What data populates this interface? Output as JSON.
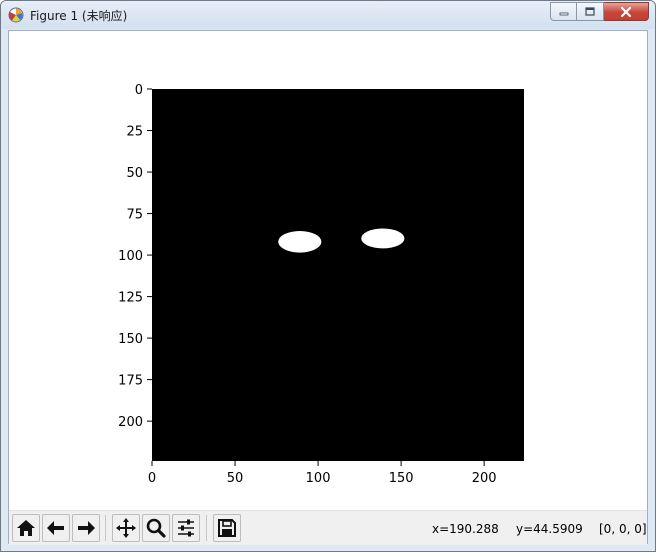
{
  "window": {
    "title": "Figure 1 (未响应)"
  },
  "figure": {
    "y_ticks": [
      "0",
      "25",
      "50",
      "75",
      "100",
      "125",
      "150",
      "175",
      "200"
    ],
    "x_ticks": [
      "0",
      "50",
      "100",
      "150",
      "200"
    ],
    "image_background": "#000000",
    "blob_color": "#ffffff"
  },
  "chart_data": {
    "type": "heatmap",
    "title": "",
    "xlabel": "",
    "ylabel": "",
    "xlim": [
      0,
      224
    ],
    "ylim": [
      224,
      0
    ],
    "y_ticks": [
      0,
      25,
      50,
      75,
      100,
      125,
      150,
      175,
      200
    ],
    "x_ticks": [
      0,
      50,
      100,
      150,
      200
    ],
    "grid": false,
    "regions": [
      {
        "shape": "ellipse",
        "value": 1,
        "cx": 89,
        "cy": 92,
        "rx": 13,
        "ry": 6.5
      },
      {
        "shape": "ellipse",
        "value": 1,
        "cx": 139,
        "cy": 90,
        "rx": 13,
        "ry": 6
      }
    ]
  },
  "toolbar": {
    "buttons": [
      "home-icon",
      "back-arrow-icon",
      "forward-arrow-icon",
      "pan-icon",
      "zoom-icon",
      "configure-subplots-icon",
      "save-icon"
    ]
  },
  "status": {
    "x_readout": "x=190.288",
    "y_readout": "y=44.5909",
    "pixel_value": "[0, 0, 0]"
  }
}
